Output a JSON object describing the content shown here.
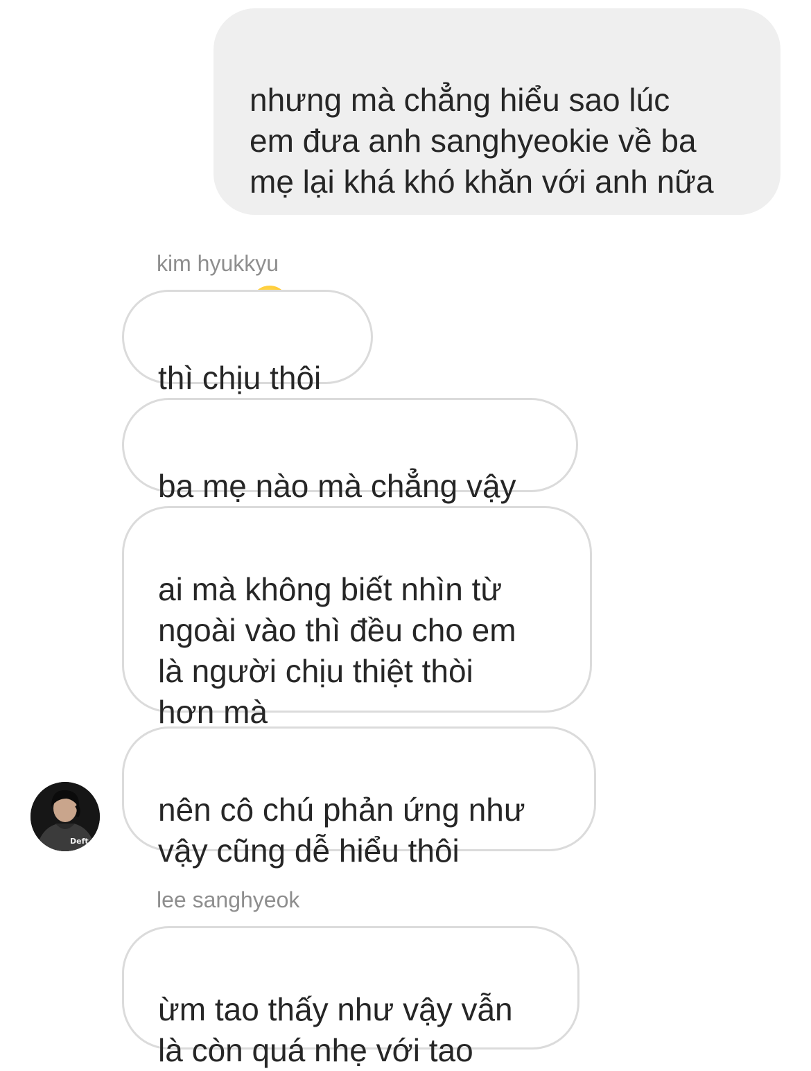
{
  "thread": {
    "sent_message": {
      "text": "nhưng mà chẳng hiểu sao lúc\nem đưa anh sanghyeokie về ba\nmẹ lại khá khó khăn với anh nữa",
      "emoji": "face-holding-back-tears"
    },
    "groups": [
      {
        "sender": "kim hyukkyu",
        "messages": [
          "thì chịu thôi",
          "ba mẹ nào mà chẳng vậy",
          "ai mà không biết nhìn từ\nngoài vào thì đều cho em\nlà người chịu thiệt thòi\nhơn mà",
          "nên cô chú phản ứng như\nvậy cũng dễ hiểu thôi"
        ]
      },
      {
        "sender": "lee sanghyeok",
        "messages": [
          "ừm tao thấy như vậy vẫn\nlà còn quá nhẹ với tao"
        ]
      }
    ],
    "avatar": {
      "icon": "profile-photo",
      "text": "Deft"
    }
  },
  "colors": {
    "sent_bubble": "#efefef",
    "received_border": "#dbdbdb",
    "sender_label": "#8e8e8e",
    "text": "#262626"
  }
}
